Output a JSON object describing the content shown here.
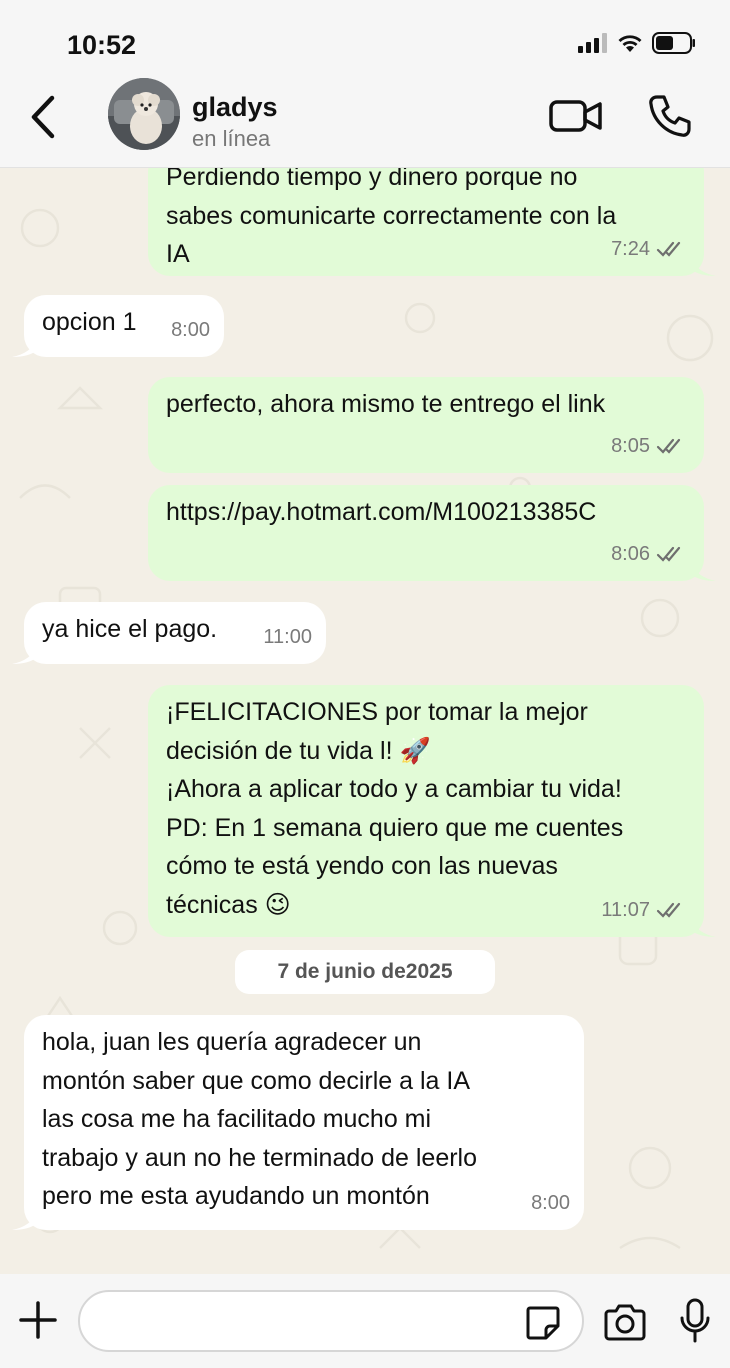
{
  "status_bar": {
    "time": "10:52"
  },
  "header": {
    "contact_name": "gladys",
    "contact_status": "en línea",
    "icons": [
      "back-chevron-icon",
      "avatar",
      "video-call-icon",
      "phone-icon"
    ]
  },
  "messages": [
    {
      "direction": "out",
      "text": "Perdiendo tiempo y dinero porque no\nsabes comunicarte correctamente con la\nIA",
      "time": "7:24",
      "status": "read"
    },
    {
      "direction": "in",
      "text": "opcion 1",
      "time": "8:00"
    },
    {
      "direction": "out",
      "text": "perfecto, ahora mismo te entrego el link",
      "time": "8:05",
      "status": "read"
    },
    {
      "direction": "out",
      "text": "https://pay.hotmart.com/M100213385C",
      "time": "8:06",
      "status": "read"
    },
    {
      "direction": "in",
      "text": "ya hice el pago.",
      "time": "11:00"
    },
    {
      "direction": "out",
      "text": "¡FELICITACIONES por tomar la mejor\ndecisión de tu vida l! 🚀\n¡Ahora a aplicar todo y a cambiar tu vida!\nPD: En 1 semana quiero que me cuentes\ncómo te está yendo con las nuevas\ntécnicas 😉",
      "time": "11:07",
      "status": "read"
    },
    {
      "direction": "in",
      "text": "hola, juan les quería agradecer  un\nmontón saber que como decirle a la IA\nlas cosa me ha facilitado mucho mi\ntrabajo y aun  no he terminado de leerlo\npero me esta ayudando un montón",
      "time": "8:00"
    }
  ],
  "date_separator": "7 de junio de2025",
  "input": {
    "placeholder": "",
    "value": ""
  },
  "colors": {
    "outgoing_bubble": "#e2fbd7",
    "incoming_bubble": "#ffffff",
    "chat_background": "#f3efe6",
    "bars": "#f6f6f6",
    "read_ticks": "#6f6f6f"
  }
}
